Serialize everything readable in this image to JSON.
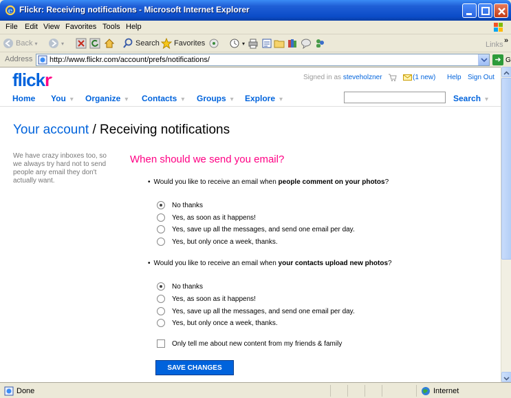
{
  "window": {
    "title": "Flickr: Receiving notifications - Microsoft Internet Explorer"
  },
  "menu": [
    "File",
    "Edit",
    "View",
    "Favorites",
    "Tools",
    "Help"
  ],
  "toolbar": {
    "back": "Back",
    "search": "Search",
    "favorites": "Favorites",
    "links": "Links",
    "chevron": "»"
  },
  "address": {
    "label": "Address",
    "url": "http://www.flickr.com/account/prefs/notifications/",
    "go": "Go"
  },
  "status": {
    "left": "Done",
    "zone": "Internet"
  },
  "flickr": {
    "logo_blue": "flick",
    "logo_pink": "r",
    "logo_dot": "·",
    "signed_in_as": "Signed in as",
    "username": "steveholzner",
    "mail": "(1 new)",
    "help": "Help",
    "sign_out": "Sign Out",
    "nav": {
      "home": "Home",
      "you": "You",
      "organize": "Organize",
      "contacts": "Contacts",
      "groups": "Groups",
      "explore": "Explore",
      "search": "Search",
      "caret": "▾"
    }
  },
  "page": {
    "title_account": "Your account",
    "title_rest": " / Receiving notifications",
    "sidebar_note": "We have crazy inboxes too, so we always try hard not to send people any email they don't actually want.",
    "section_heading": "When should we send you email?",
    "q1_prefix": "Would you like to receive an email when ",
    "q1_bold": "people comment on your photos",
    "q1_suffix": "?",
    "q2_prefix": "Would you like to receive an email when ",
    "q2_bold": "your contacts upload new photos",
    "q2_suffix": "?",
    "options": [
      "No thanks",
      "Yes, as soon as it happens!",
      "Yes, save up all the messages, and send one email per day.",
      "Yes, but only once a week, thanks."
    ],
    "q1_selected": "No thanks",
    "q2_selected": "No thanks",
    "friends_family_label": "Only tell me about new content from my friends & family",
    "friends_family_checked": false,
    "save_button": "SAVE CHANGES"
  },
  "colors": {
    "flickr_blue": "#0063dc",
    "flickr_pink": "#ff0084",
    "xp_title": "#0b4cc8"
  }
}
